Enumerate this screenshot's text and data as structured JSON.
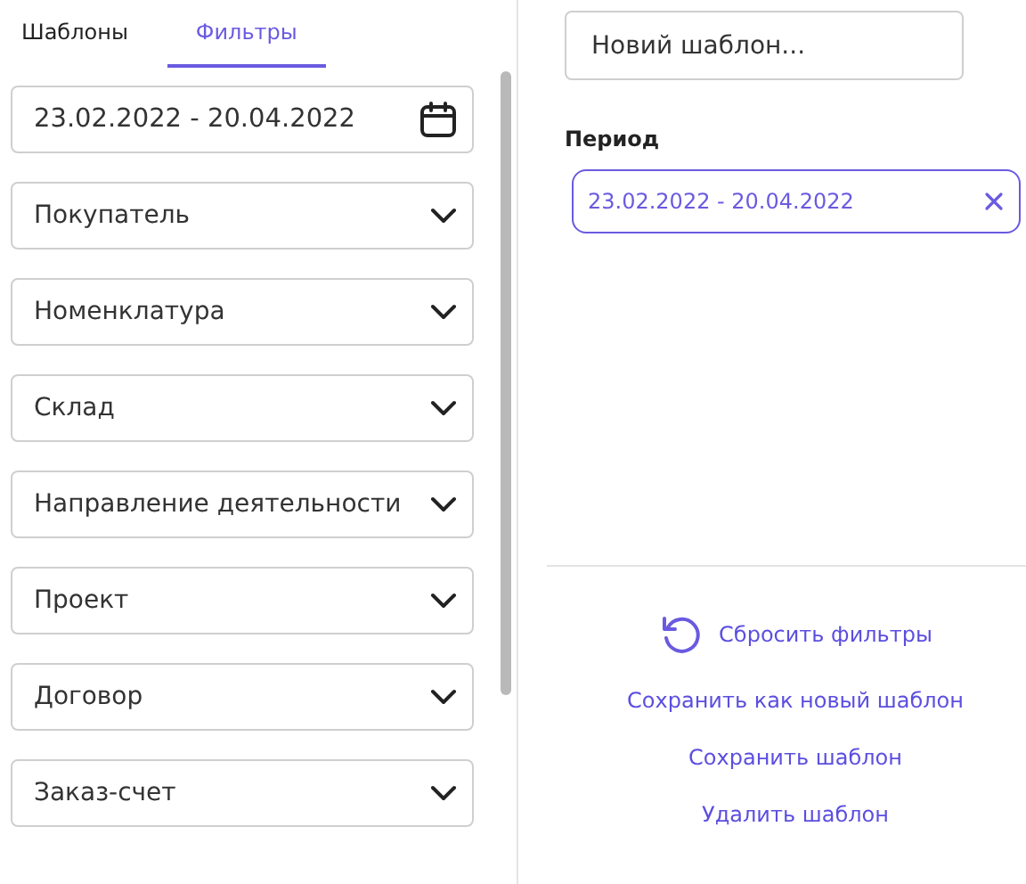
{
  "tabs": [
    {
      "label": "Шаблоны",
      "selected": false
    },
    {
      "label": "Фильтры",
      "selected": true
    }
  ],
  "date_field": {
    "value": "23.02.2022 - 20.04.2022"
  },
  "filters": [
    {
      "label": "Покупатель"
    },
    {
      "label": "Номенклатура"
    },
    {
      "label": "Склад"
    },
    {
      "label": "Направление деятельности"
    },
    {
      "label": "Проект"
    },
    {
      "label": "Договор"
    },
    {
      "label": "Заказ-счет"
    }
  ],
  "template_field": {
    "placeholder": "Новий шаблон..."
  },
  "period": {
    "label": "Период",
    "value": "23.02.2022 - 20.04.2022"
  },
  "actions": [
    {
      "label": "Сбросить фильтры",
      "kind": "reset"
    },
    {
      "label": "Сохранить как новый шаблон",
      "kind": "link"
    },
    {
      "label": "Сохранить шаблон",
      "kind": "link"
    },
    {
      "label": "Удалить шаблон",
      "kind": "link"
    }
  ]
}
